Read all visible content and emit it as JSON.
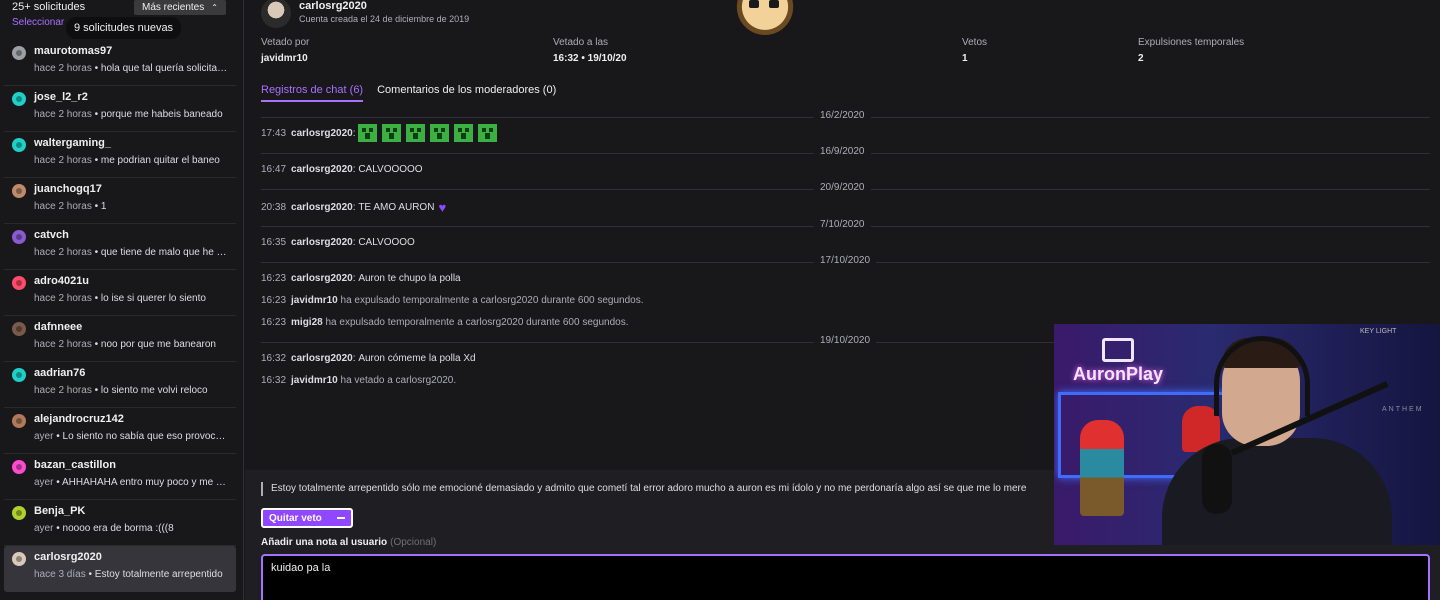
{
  "sidebar": {
    "count_label": "25+ solicitudes",
    "sort_label": "Más recientes",
    "select_label": "Seleccionar",
    "tooltip": "9 solicitudes nuevas",
    "requests": [
      {
        "name": "maurotomas97",
        "time": "hace 2 horas",
        "sep": " • ",
        "preview": "hola que tal quería solicitar el desbaneo",
        "avatar_color": "#9aa0a6"
      },
      {
        "name": "jose_l2_r2",
        "time": "hace 2 horas",
        "sep": " • ",
        "preview": "porque me habeis baneado",
        "avatar_color": "#1ed0c8"
      },
      {
        "name": "waltergaming_",
        "time": "hace 2 horas",
        "sep": " • ",
        "preview": "me podrian quitar el baneo",
        "avatar_color": "#1ed0c8"
      },
      {
        "name": "juanchogq17",
        "time": "hace 2 horas",
        "sep": " • ",
        "preview": "1",
        "avatar_color": "#c08a6a"
      },
      {
        "name": "catvch",
        "time": "hace 2 horas",
        "sep": " • ",
        "preview": "que tiene de malo que he dicho",
        "avatar_color": "#8a5ad0"
      },
      {
        "name": "adro4021u",
        "time": "hace 2 horas",
        "sep": " • ",
        "preview": "lo ise si querer lo siento",
        "avatar_color": "#ff4a6a"
      },
      {
        "name": "dafnneee",
        "time": "hace 2 horas",
        "sep": " • ",
        "preview": "noo por que me banearon",
        "avatar_color": "#7a5a4a"
      },
      {
        "name": "aadrian76",
        "time": "hace 2 horas",
        "sep": " • ",
        "preview": "lo siento me volvi reloco",
        "avatar_color": "#1ed0c8"
      },
      {
        "name": "alejandrocruz142",
        "time": "ayer",
        "sep": " • ",
        "preview": "Lo siento no sabía que eso provocaba",
        "avatar_color": "#b07a5a"
      },
      {
        "name": "bazan_castillon",
        "time": "ayer",
        "sep": " • ",
        "preview": "AHHAHAHA entro muy poco y me banean",
        "avatar_color": "#ff4ad0"
      },
      {
        "name": "Benja_PK",
        "time": "ayer",
        "sep": " • ",
        "preview": "noooo era de borma :(((8",
        "avatar_color": "#b0d030"
      },
      {
        "name": "carlosrg2020",
        "time": "hace 3 días",
        "sep": " • ",
        "preview": "Estoy totalmente arrepentido",
        "avatar_color": "#d9c9b9"
      }
    ]
  },
  "user": {
    "name": "carlosrg2020",
    "created": "Cuenta creada el 24 de diciembre de 2019"
  },
  "stats": [
    {
      "label": "Vetado por",
      "value": "javidmr10"
    },
    {
      "label": "Vetado a las",
      "value": "16:32 • 19/10/20"
    },
    {
      "label": "Vetos",
      "value": "1"
    },
    {
      "label": "Expulsiones temporales",
      "value": "2"
    }
  ],
  "tabs": [
    {
      "label": "Registros de chat (6)"
    },
    {
      "label": "Comentarios de los moderadores (0)"
    }
  ],
  "log": {
    "dates": [
      "16/2/2020",
      "16/9/2020",
      "20/9/2020",
      "7/10/2020",
      "17/10/2020",
      "19/10/2020"
    ],
    "messages": [
      {
        "time": "17:43",
        "user": "carlosrg2020",
        "text": ""
      },
      {
        "time": "16:47",
        "user": "carlosrg2020",
        "text": "CALVOOOOO"
      },
      {
        "time": "20:38",
        "user": "carlosrg2020",
        "text": "TE AMO AURON"
      },
      {
        "time": "16:35",
        "user": "carlosrg2020",
        "text": "CALVOOOO"
      },
      {
        "time": "16:23",
        "user": "carlosrg2020",
        "text": "Auron te chupo la polla"
      },
      {
        "time": "16:23",
        "user": "javidmr10",
        "text": "ha expulsado temporalmente a carlosrg2020 durante 600 segundos."
      },
      {
        "time": "16:23",
        "user": "migi28",
        "text": "ha expulsado temporalmente a carlosrg2020 durante 600 segundos."
      },
      {
        "time": "16:32",
        "user": "carlosrg2020",
        "text": "Auron cómeme la polla Xd"
      },
      {
        "time": "16:32",
        "user": "javidmr10",
        "text": "ha vetado a carlosrg2020."
      }
    ],
    "emote_name": "creeper-emote",
    "emote_count": 6
  },
  "appeal": {
    "text": "Estoy totalmente arrepentido sólo me emocioné demasiado y admito que cometí tal error adoro mucho a auron es mi ídolo y no me perdonaría algo así se que me lo mere",
    "unban_label": "Quitar veto",
    "note_label": "Añadir una nota al usuario",
    "note_optional": "(Opcional)",
    "note_value": "kuidao pa la "
  },
  "webcam": {
    "brand": "AuronPlay",
    "keylight": "KEY LIGHT",
    "anthem": "ANTHEM"
  },
  "colors": {
    "accent": "#a970ff",
    "button": "#9147ff",
    "background": "#18181b"
  }
}
